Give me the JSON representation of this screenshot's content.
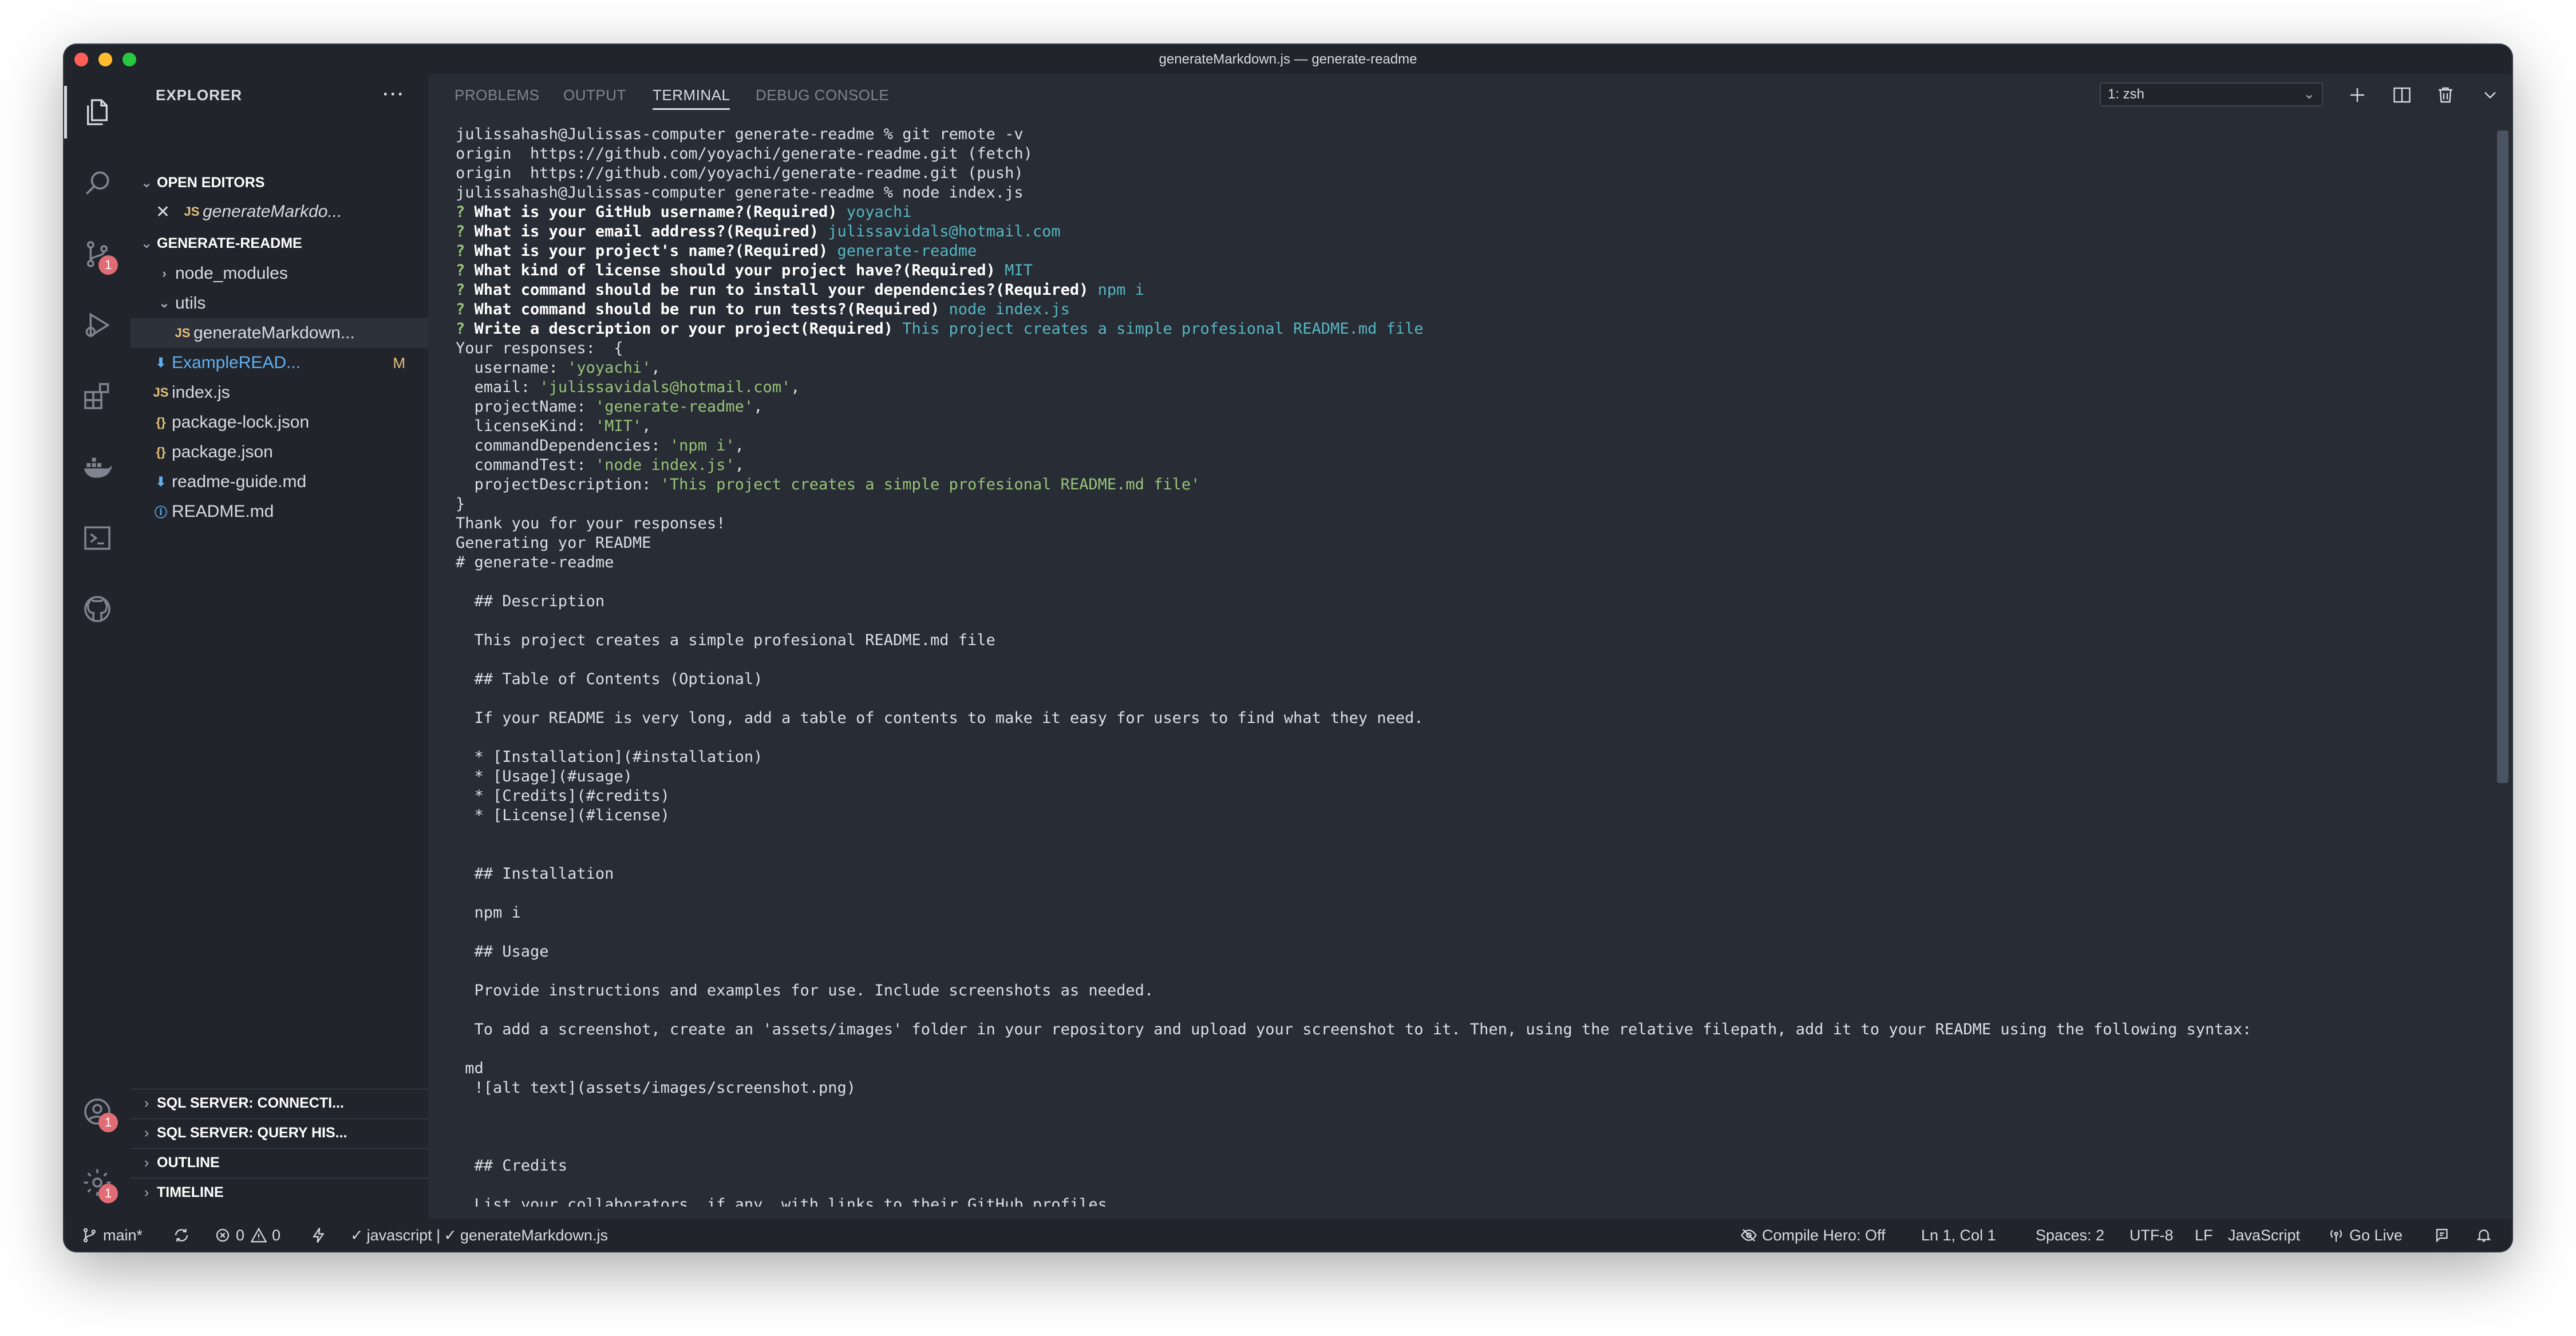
{
  "window": {
    "title": "generateMarkdown.js — generate-readme"
  },
  "explorer": {
    "title": "EXPLORER",
    "more": "···",
    "open_editors": {
      "label": "OPEN EDITORS",
      "items": [
        {
          "icon": "JS",
          "name": "generateMarkdo..."
        }
      ]
    },
    "project": {
      "label": "GENERATE-README",
      "items": [
        {
          "kind": "folder",
          "name": "node_modules"
        },
        {
          "kind": "folder-open",
          "name": "utils"
        },
        {
          "kind": "js",
          "icon": "JS",
          "name": "generateMarkdown..."
        },
        {
          "kind": "md",
          "icon": "⬇",
          "name": "ExampleREAD...",
          "status": "M"
        },
        {
          "kind": "js",
          "icon": "JS",
          "name": "index.js"
        },
        {
          "kind": "json",
          "icon": "{}",
          "name": "package-lock.json"
        },
        {
          "kind": "json",
          "icon": "{}",
          "name": "package.json"
        },
        {
          "kind": "md",
          "icon": "⬇",
          "name": "readme-guide.md"
        },
        {
          "kind": "info",
          "icon": "ⓘ",
          "name": "README.md"
        }
      ]
    },
    "bottom_sections": [
      "SQL SERVER: CONNECTI...",
      "SQL SERVER: QUERY HIS...",
      "OUTLINE",
      "TIMELINE"
    ]
  },
  "activity_bar": {
    "icons": [
      "files-icon",
      "search-icon",
      "source-control-icon",
      "run-debug-icon",
      "extensions-icon",
      "docker-icon",
      "remote-explorer-icon",
      "github-icon"
    ],
    "source_control_badge": "1",
    "accounts_badge": "1",
    "settings_badge": "1"
  },
  "panel": {
    "tabs": [
      "PROBLEMS",
      "OUTPUT",
      "TERMINAL",
      "DEBUG CONSOLE"
    ],
    "active_tab": "TERMINAL",
    "terminal_select": "1: zsh"
  },
  "terminal": {
    "lines": [
      {
        "segs": [
          {
            "t": "julissahash@Julissas-computer generate-readme % git remote -v"
          }
        ]
      },
      {
        "segs": [
          {
            "t": "origin  https://github.com/yoyachi/generate-readme.git (fetch)"
          }
        ]
      },
      {
        "segs": [
          {
            "t": "origin  https://github.com/yoyachi/generate-readme.git (push)"
          }
        ]
      },
      {
        "segs": [
          {
            "t": "julissahash@Julissas-computer generate-readme % node index.js"
          }
        ]
      },
      {
        "segs": [
          {
            "t": "? ",
            "c": "q-mark"
          },
          {
            "t": "What is your GitHub username?(Required) ",
            "c": "q-text"
          },
          {
            "t": "yoyachi",
            "c": "ans"
          }
        ]
      },
      {
        "segs": [
          {
            "t": "? ",
            "c": "q-mark"
          },
          {
            "t": "What is your email address?(Required) ",
            "c": "q-text"
          },
          {
            "t": "julissavidals@hotmail.com",
            "c": "ans"
          }
        ]
      },
      {
        "segs": [
          {
            "t": "? ",
            "c": "q-mark"
          },
          {
            "t": "What is your project's name?(Required) ",
            "c": "q-text"
          },
          {
            "t": "generate-readme",
            "c": "ans"
          }
        ]
      },
      {
        "segs": [
          {
            "t": "? ",
            "c": "q-mark"
          },
          {
            "t": "What kind of license should your project have?(Required) ",
            "c": "q-text"
          },
          {
            "t": "MIT",
            "c": "ans"
          }
        ]
      },
      {
        "segs": [
          {
            "t": "? ",
            "c": "q-mark"
          },
          {
            "t": "What command should be run to install your dependencies?(Required) ",
            "c": "q-text"
          },
          {
            "t": "npm i",
            "c": "ans"
          }
        ]
      },
      {
        "segs": [
          {
            "t": "? ",
            "c": "q-mark"
          },
          {
            "t": "What command should be run to run tests?(Required) ",
            "c": "q-text"
          },
          {
            "t": "node index.js",
            "c": "ans"
          }
        ]
      },
      {
        "segs": [
          {
            "t": "? ",
            "c": "q-mark"
          },
          {
            "t": "Write a description or your project(Required) ",
            "c": "q-text"
          },
          {
            "t": "This project creates a simple profesional README.md file",
            "c": "ans"
          }
        ]
      },
      {
        "segs": [
          {
            "t": "Your responses:  {"
          }
        ]
      },
      {
        "segs": [
          {
            "t": "  username: "
          },
          {
            "t": "'yoyachi'",
            "c": "str"
          },
          {
            "t": ","
          }
        ]
      },
      {
        "segs": [
          {
            "t": "  email: "
          },
          {
            "t": "'julissavidals@hotmail.com'",
            "c": "str"
          },
          {
            "t": ","
          }
        ]
      },
      {
        "segs": [
          {
            "t": "  projectName: "
          },
          {
            "t": "'generate-readme'",
            "c": "str"
          },
          {
            "t": ","
          }
        ]
      },
      {
        "segs": [
          {
            "t": "  licenseKind: "
          },
          {
            "t": "'MIT'",
            "c": "str"
          },
          {
            "t": ","
          }
        ]
      },
      {
        "segs": [
          {
            "t": "  commandDependencies: "
          },
          {
            "t": "'npm i'",
            "c": "str"
          },
          {
            "t": ","
          }
        ]
      },
      {
        "segs": [
          {
            "t": "  commandTest: "
          },
          {
            "t": "'node index.js'",
            "c": "str"
          },
          {
            "t": ","
          }
        ]
      },
      {
        "segs": [
          {
            "t": "  projectDescription: "
          },
          {
            "t": "'This project creates a simple profesional README.md file'",
            "c": "str"
          }
        ]
      },
      {
        "segs": [
          {
            "t": "}"
          }
        ]
      },
      {
        "segs": [
          {
            "t": "Thank you for your responses!"
          }
        ]
      },
      {
        "segs": [
          {
            "t": "Generating yor README"
          }
        ]
      },
      {
        "segs": [
          {
            "t": "# generate-readme"
          }
        ]
      },
      {
        "segs": [
          {
            "t": ""
          }
        ]
      },
      {
        "segs": [
          {
            "t": "  ## Description"
          }
        ]
      },
      {
        "segs": [
          {
            "t": ""
          }
        ]
      },
      {
        "segs": [
          {
            "t": "  This project creates a simple profesional README.md file"
          }
        ]
      },
      {
        "segs": [
          {
            "t": ""
          }
        ]
      },
      {
        "segs": [
          {
            "t": "  ## Table of Contents (Optional)"
          }
        ]
      },
      {
        "segs": [
          {
            "t": ""
          }
        ]
      },
      {
        "segs": [
          {
            "t": "  If your README is very long, add a table of contents to make it easy for users to find what they need."
          }
        ]
      },
      {
        "segs": [
          {
            "t": ""
          }
        ]
      },
      {
        "segs": [
          {
            "t": "  * [Installation](#installation)"
          }
        ]
      },
      {
        "segs": [
          {
            "t": "  * [Usage](#usage)"
          }
        ]
      },
      {
        "segs": [
          {
            "t": "  * [Credits](#credits)"
          }
        ]
      },
      {
        "segs": [
          {
            "t": "  * [License](#license)"
          }
        ]
      },
      {
        "segs": [
          {
            "t": ""
          }
        ]
      },
      {
        "segs": [
          {
            "t": ""
          }
        ]
      },
      {
        "segs": [
          {
            "t": "  ## Installation"
          }
        ]
      },
      {
        "segs": [
          {
            "t": ""
          }
        ]
      },
      {
        "segs": [
          {
            "t": "  npm i"
          }
        ]
      },
      {
        "segs": [
          {
            "t": ""
          }
        ]
      },
      {
        "segs": [
          {
            "t": "  ## Usage"
          }
        ]
      },
      {
        "segs": [
          {
            "t": ""
          }
        ]
      },
      {
        "segs": [
          {
            "t": "  Provide instructions and examples for use. Include screenshots as needed."
          }
        ]
      },
      {
        "segs": [
          {
            "t": ""
          }
        ]
      },
      {
        "segs": [
          {
            "t": "  To add a screenshot, create an 'assets/images' folder in your repository and upload your screenshot to it. Then, using the relative filepath, add it to your README using the following syntax:"
          }
        ]
      },
      {
        "segs": [
          {
            "t": ""
          }
        ]
      },
      {
        "segs": [
          {
            "t": " md"
          }
        ]
      },
      {
        "segs": [
          {
            "t": "  ![alt text](assets/images/screenshot.png)"
          }
        ]
      },
      {
        "segs": [
          {
            "t": ""
          }
        ]
      },
      {
        "segs": [
          {
            "t": ""
          }
        ]
      },
      {
        "segs": [
          {
            "t": ""
          }
        ]
      },
      {
        "segs": [
          {
            "t": "  ## Credits"
          }
        ]
      },
      {
        "segs": [
          {
            "t": ""
          }
        ]
      },
      {
        "segs": [
          {
            "t": "  List your collaborators, if any, with links to their GitHub profiles."
          }
        ]
      }
    ]
  },
  "status_bar": {
    "branch": "main*",
    "errors": "0",
    "warnings": "0",
    "language_check": "javascript | ",
    "file_check": "generateMarkdown.js",
    "compile_hero": "Compile Hero: Off",
    "cursor": "Ln 1, Col 1",
    "spaces": "Spaces: 2",
    "encoding": "UTF-8",
    "eol": "LF",
    "language": "JavaScript",
    "go_live": "Go Live"
  }
}
